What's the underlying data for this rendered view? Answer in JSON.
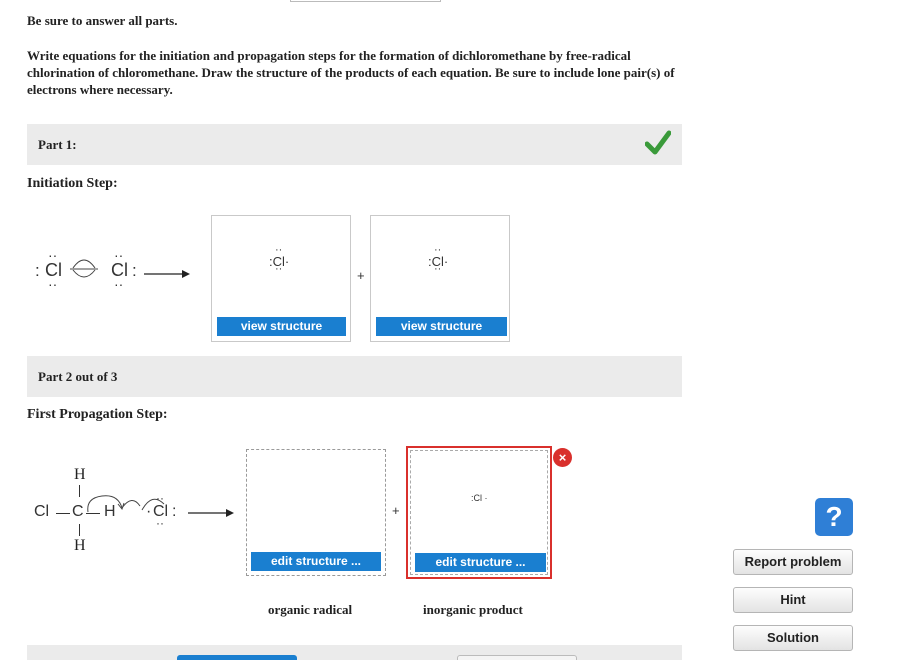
{
  "header": {
    "instruction": "Be sure to answer all parts."
  },
  "question": {
    "text": "Write equations for the initiation and propagation steps for the formation of dichloromethane by free-radical chlorination of chloromethane. Draw the structure of the products of each equation. Be sure to include lone pair(s) of electrons where necessary."
  },
  "part1": {
    "label": "Part 1:",
    "status": "correct",
    "step_title": "Initiation Step:",
    "reactant_left": "Cl",
    "reactant_right": "Cl",
    "plus": "+",
    "products": [
      {
        "symbol": "Cl",
        "button": "view structure"
      },
      {
        "symbol": "Cl",
        "button": "view structure"
      }
    ]
  },
  "part2": {
    "label": "Part 2 out of 3",
    "step_title": "First Propagation Step:",
    "reactant": {
      "h_top": "H",
      "h_bottom": "H",
      "cl_left": "Cl",
      "c": "C",
      "h_right": "H",
      "cl_radical": "Cl"
    },
    "plus": "+",
    "products": [
      {
        "symbol": "",
        "button": "edit structure ...",
        "caption": "organic radical"
      },
      {
        "symbol": "Cl",
        "button": "edit structure ...",
        "caption": "inorganic product"
      }
    ]
  },
  "sidebar": {
    "help_icon": "?",
    "report_problem": "Report problem",
    "hint": "Hint",
    "solution": "Solution"
  },
  "colors": {
    "accent_blue": "#1a7fd0",
    "check_green": "#3a9a3a",
    "error_red": "#d9302c",
    "bar_gray": "#ebebeb"
  }
}
